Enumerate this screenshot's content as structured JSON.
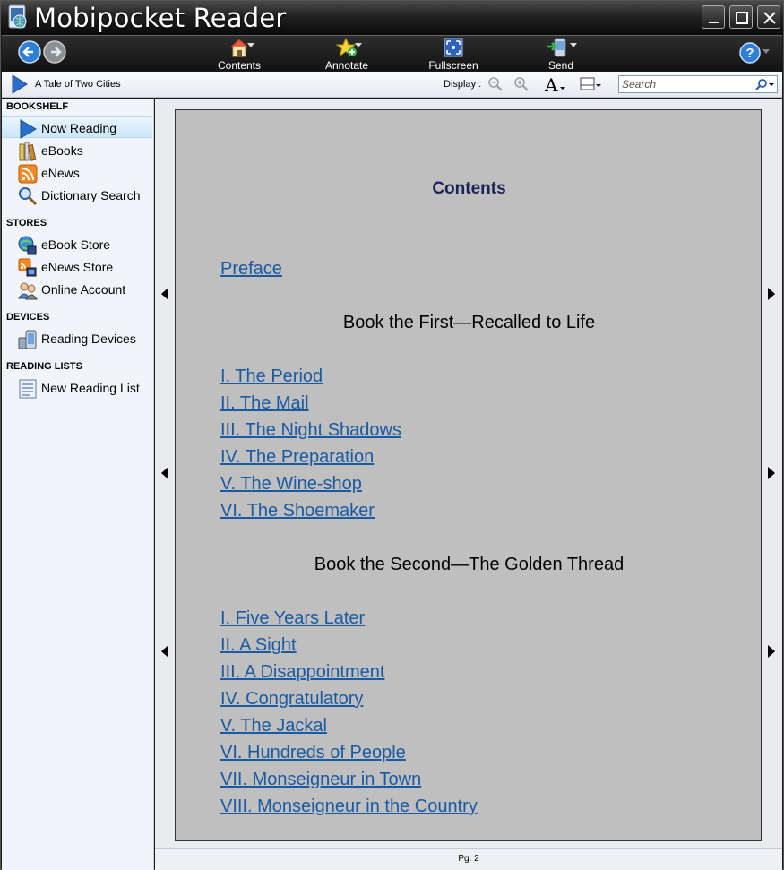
{
  "window": {
    "title": "Mobipocket Reader"
  },
  "toolbar": {
    "contents_label": "Contents",
    "annotate_label": "Annotate",
    "fullscreen_label": "Fullscreen",
    "send_label": "Send",
    "icons": {
      "back": "back-arrow-icon",
      "forward": "forward-arrow-icon",
      "contents": "home-icon",
      "annotate": "star-plus-icon",
      "fullscreen": "fullscreen-icon",
      "send": "send-device-icon",
      "help": "help-icon"
    }
  },
  "addressbar": {
    "book_title": "A Tale of Two Cities",
    "display_label": "Display :",
    "search_placeholder": "Search"
  },
  "sidebar": {
    "sections": [
      {
        "title": "BOOKSHELF",
        "items": [
          {
            "label": "Now Reading",
            "icon": "play-icon",
            "selected": true
          },
          {
            "label": "eBooks",
            "icon": "books-icon"
          },
          {
            "label": "eNews",
            "icon": "rss-icon"
          },
          {
            "label": "Dictionary Search",
            "icon": "magnifier-icon"
          }
        ]
      },
      {
        "title": "STORES",
        "items": [
          {
            "label": "eBook Store",
            "icon": "globe-book-icon"
          },
          {
            "label": "eNews Store",
            "icon": "rss-globe-icon"
          },
          {
            "label": "Online Account",
            "icon": "users-icon"
          }
        ]
      },
      {
        "title": "DEVICES",
        "items": [
          {
            "label": "Reading Devices",
            "icon": "devices-icon"
          }
        ]
      },
      {
        "title": "READING LISTS",
        "items": [
          {
            "label": "New Reading List",
            "icon": "list-icon"
          }
        ]
      }
    ]
  },
  "page": {
    "heading": "Contents",
    "preface": "Preface",
    "book1": {
      "title": "Book the First—Recalled to Life",
      "chapters": [
        "I. The Period",
        "II. The Mail",
        "III. The Night Shadows",
        "IV. The Preparation",
        "V. The Wine-shop",
        "VI. The Shoemaker"
      ]
    },
    "book2": {
      "title": "Book the Second—The Golden Thread",
      "chapters": [
        "I. Five Years Later",
        "II. A Sight",
        "III. A Disappointment",
        "IV. Congratulatory",
        "V. The Jackal",
        "VI. Hundreds of People",
        "VII. Monseigneur in Town",
        "VIII. Monseigneur in the Country"
      ]
    }
  },
  "status": {
    "page_number": "Pg. 2"
  },
  "colors": {
    "link": "#1a5aa3",
    "heading": "#1d2455",
    "page_bg": "#bfbfbf",
    "sidebar_bg": "#f1f4f9",
    "chrome_dark": "#121212"
  }
}
